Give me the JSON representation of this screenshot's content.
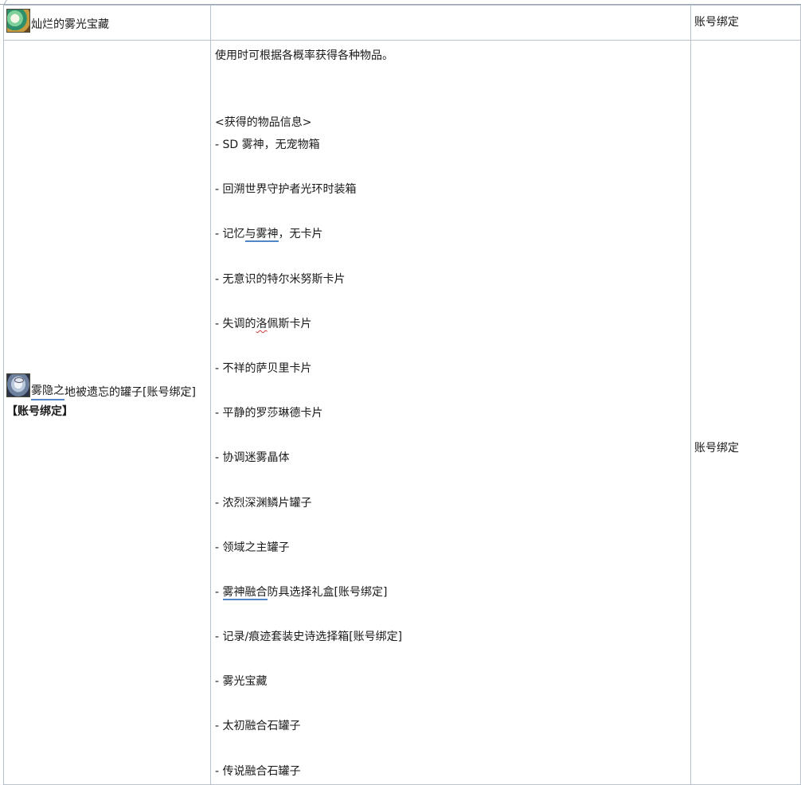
{
  "header_row": {
    "item_name": "灿烂的雾光宝藏",
    "item_icon": "treasure-box-icon",
    "description": "",
    "binding": "账号绑定"
  },
  "main_row": {
    "item_name_part1": "雾隐之",
    "item_name_part2": "地被遗忘的罐子[账号绑定]",
    "item_icon": "misty-jar-icon",
    "item_bind_tag": "【账号绑定】",
    "intro": "使用时可根据各概率获得各种物品。",
    "list_header": "<获得的物品信息>",
    "items": [
      "- SD 雾神，无宠物箱",
      "- 回溯世界守护者光环时装箱",
      "- 记忆与雾神，无卡片",
      "- 无意识的特尔米努斯卡片",
      "- 失调的洛佩斯卡片",
      "- 不祥的萨贝里卡片",
      "- 平静的罗莎琳德卡片",
      "- 协调迷雾晶体",
      "- 浓烈深渊鳞片罐子",
      "- 领域之主罐子",
      "- 雾神融合防具选择礼盒[账号绑定]",
      "- 记录/痕迹套装史诗选择箱[账号绑定]",
      "- 雾光宝藏",
      "- 太初融合石罐子",
      "- 传说融合石罐子"
    ],
    "binding": "账号绑定"
  },
  "colors": {
    "border": "#b7c2cc",
    "text": "#1a1a1a",
    "spell_underline": "#d23a3a",
    "link_underline": "#4f86c6"
  }
}
